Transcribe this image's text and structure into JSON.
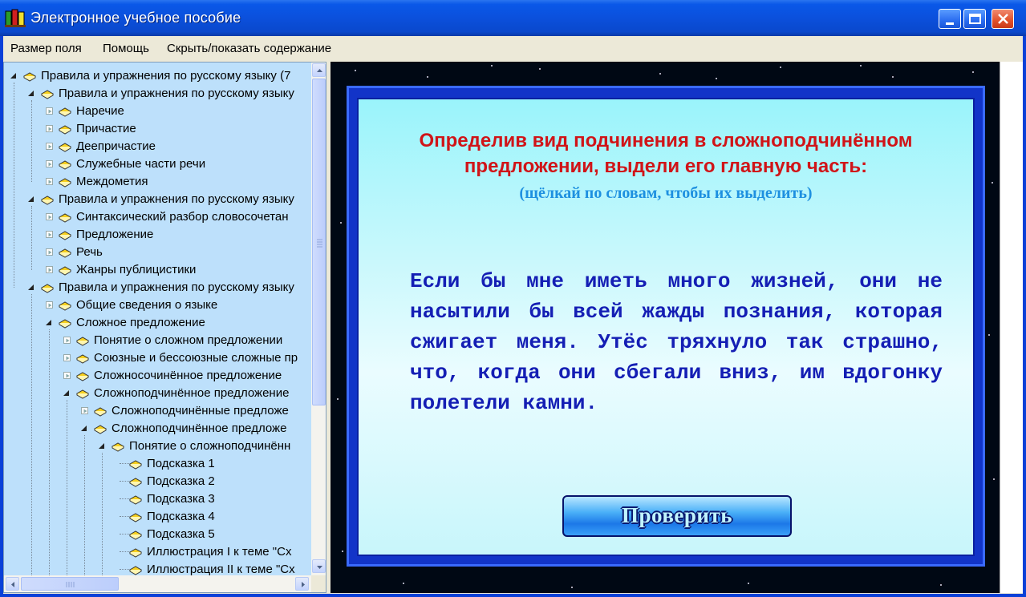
{
  "window": {
    "title": "Электронное учебное пособие"
  },
  "menu": {
    "items": [
      "Размер поля",
      "Помощь",
      "Скрыть/показать содержание"
    ]
  },
  "tree": {
    "nodes": [
      {
        "label": "Правила и упражнения по русскому языку (7",
        "level": 0,
        "expander": "expanded"
      },
      {
        "label": "Правила и упражнения по русскому языку",
        "level": 1,
        "expander": "expanded"
      },
      {
        "label": "Наречие",
        "level": 2,
        "expander": "collapsed"
      },
      {
        "label": "Причастие",
        "level": 2,
        "expander": "collapsed"
      },
      {
        "label": "Деепричастие",
        "level": 2,
        "expander": "collapsed"
      },
      {
        "label": "Служебные части речи",
        "level": 2,
        "expander": "collapsed"
      },
      {
        "label": "Междометия",
        "level": 2,
        "expander": "collapsed"
      },
      {
        "label": "Правила и упражнения по русскому языку",
        "level": 1,
        "expander": "expanded"
      },
      {
        "label": "Синтаксический разбор словосочетан",
        "level": 2,
        "expander": "collapsed"
      },
      {
        "label": "Предложение",
        "level": 2,
        "expander": "collapsed"
      },
      {
        "label": "Речь",
        "level": 2,
        "expander": "collapsed"
      },
      {
        "label": "Жанры публицистики",
        "level": 2,
        "expander": "collapsed"
      },
      {
        "label": "Правила и упражнения по русскому языку",
        "level": 1,
        "expander": "expanded"
      },
      {
        "label": "Общие сведения о языке",
        "level": 2,
        "expander": "collapsed"
      },
      {
        "label": "Сложное предложение",
        "level": 2,
        "expander": "expanded"
      },
      {
        "label": "Понятие о сложном предложении",
        "level": 3,
        "expander": "collapsed"
      },
      {
        "label": "Союзные и бессоюзные сложные пр",
        "level": 3,
        "expander": "collapsed"
      },
      {
        "label": "Сложносочинённое предложение",
        "level": 3,
        "expander": "collapsed"
      },
      {
        "label": "Сложноподчинённое предложение",
        "level": 3,
        "expander": "expanded"
      },
      {
        "label": "Сложноподчинённые предложе",
        "level": 4,
        "expander": "collapsed"
      },
      {
        "label": "Сложноподчинённое предложе",
        "level": 4,
        "expander": "expanded"
      },
      {
        "label": "Понятие о сложноподчинённ",
        "level": 5,
        "expander": "expanded"
      },
      {
        "label": "Подсказка 1",
        "level": 6,
        "expander": "none"
      },
      {
        "label": "Подсказка 2",
        "level": 6,
        "expander": "none"
      },
      {
        "label": "Подсказка 3",
        "level": 6,
        "expander": "none"
      },
      {
        "label": "Подсказка 4",
        "level": 6,
        "expander": "none"
      },
      {
        "label": "Подсказка 5",
        "level": 6,
        "expander": "none"
      },
      {
        "label": "Иллюстрация I к теме \"Сх",
        "level": 6,
        "expander": "none"
      },
      {
        "label": "Иллюстрация II к теме \"Сх",
        "level": 6,
        "expander": "none"
      }
    ]
  },
  "exercise": {
    "instruction": "Определив вид подчинения в сложноподчинённом предложении, выдели его главную часть:",
    "hint": "(щёлкай по словам, чтобы их выделить)",
    "sentence_words": [
      "Если",
      "бы",
      "мне",
      "иметь",
      "много",
      "жизней,",
      "они",
      "не",
      "насытили",
      "бы",
      "всей",
      "жажды",
      "познания,",
      "которая",
      "сжигает",
      "меня.",
      "Утёс",
      "тряхнуло",
      "так",
      "страшно,",
      "что,",
      "когда",
      "они",
      "сбегали",
      "вниз,",
      "им",
      "вдогонку",
      "полетели",
      "камни."
    ],
    "check_button": "Проверить"
  },
  "colors": {
    "title_bar": "#0a50dc",
    "tree_bg": "#bde0fb",
    "instruction": "#d01418",
    "hint": "#1e90e0",
    "sentence": "#141eb4",
    "panel_frame": "#1234c8"
  }
}
